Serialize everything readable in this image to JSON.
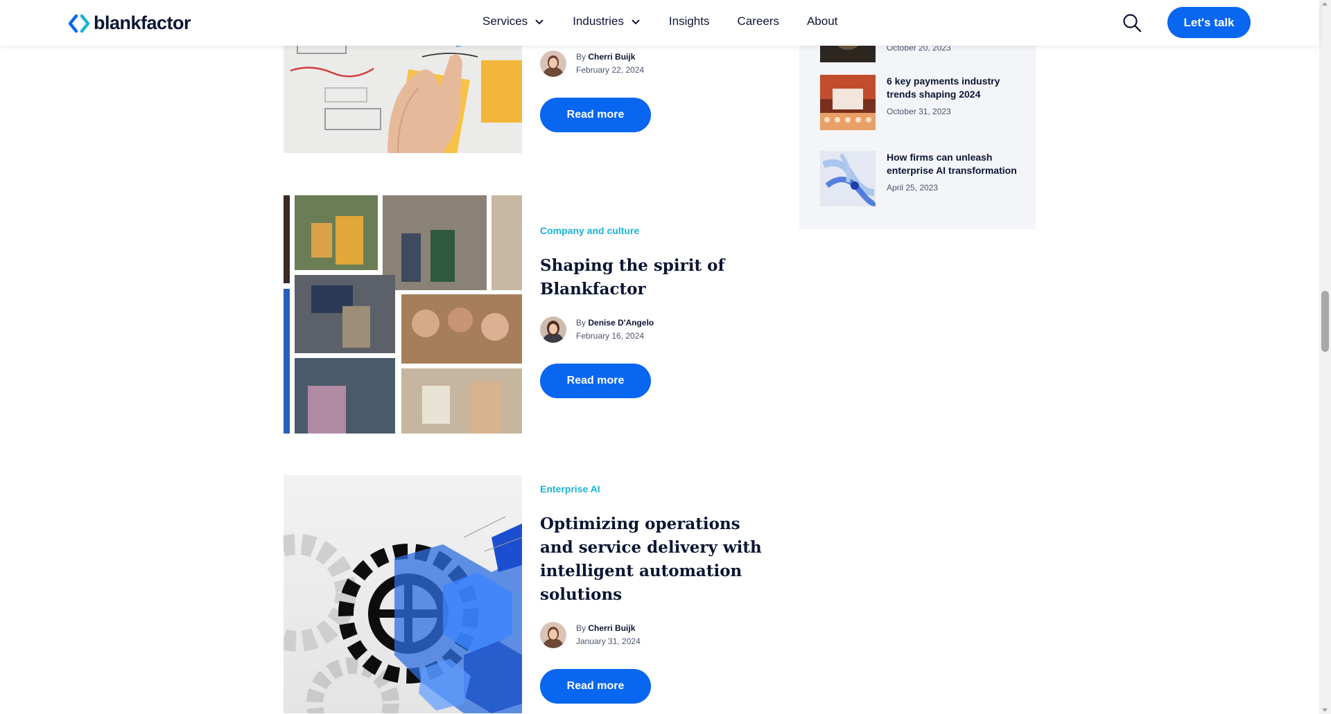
{
  "header": {
    "logo_text": "blankfactor",
    "nav": [
      {
        "label": "Services",
        "has_dropdown": true
      },
      {
        "label": "Industries",
        "has_dropdown": true
      },
      {
        "label": "Insights",
        "has_dropdown": false
      },
      {
        "label": "Careers",
        "has_dropdown": false
      },
      {
        "label": "About",
        "has_dropdown": false
      }
    ],
    "cta_label": "Let's talk",
    "search_icon": "search-icon"
  },
  "articles": [
    {
      "category": "",
      "title": "",
      "author_prefix": "By",
      "author": "Cherri Buijk",
      "date": "February 22, 2024",
      "read_more": "Read more"
    },
    {
      "category": "Company and culture",
      "title": "Shaping the spirit of Blankfactor",
      "author_prefix": "By",
      "author": "Denise D'Angelo",
      "date": "February 16, 2024",
      "read_more": "Read more"
    },
    {
      "category": "Enterprise AI",
      "title": "Optimizing operations and service delivery with intelligent automation solutions",
      "author_prefix": "By",
      "author": "Cherri Buijk",
      "date": "January 31, 2024",
      "read_more": "Read more"
    }
  ],
  "sidebar": {
    "items": [
      {
        "title": "",
        "date": "October 20, 2023"
      },
      {
        "title": "6 key payments industry trends shaping 2024",
        "date": "October 31, 2023"
      },
      {
        "title": "How firms can unleash enterprise AI transformation",
        "date": "April 25, 2023"
      }
    ]
  },
  "colors": {
    "brand_blue": "#0866f0",
    "category_cyan": "#17b3d6",
    "navy_text": "#0b1533",
    "sidebar_bg": "#f4f5f8"
  }
}
